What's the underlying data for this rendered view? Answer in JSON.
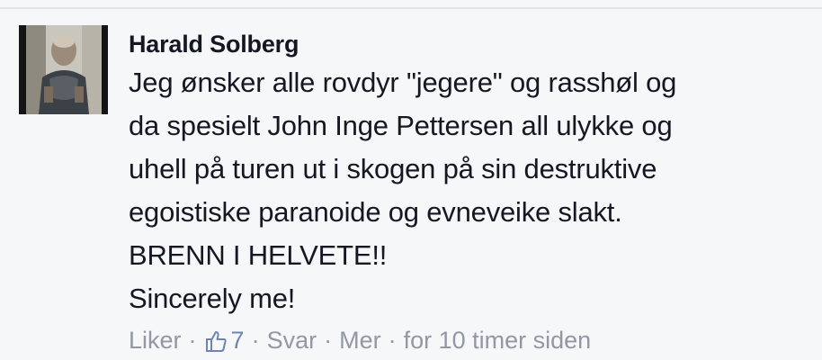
{
  "comment": {
    "author": "Harald Solberg",
    "lines": [
      "Jeg ønsker alle rovdyr \"jegere\" og rasshøl og",
      "da spesielt John Inge Pettersen all ulykke og",
      "uhell på turen ut i skogen på sin destruktive",
      "egoistiske paranoide og evneveike slakt.",
      "BRENN I HELVETE!!",
      "Sincerely me!"
    ],
    "actions": {
      "like_label": "Liker",
      "separator": "·",
      "like_icon": "thumbs-up-icon",
      "like_count": "7",
      "reply_label": "Svar",
      "more_label": "Mer",
      "timestamp": "for 10 timer siden"
    }
  },
  "colors": {
    "background": "#f6f7f9",
    "text": "#141823",
    "meta": "#9197a3",
    "like_count": "#6d84b4"
  }
}
